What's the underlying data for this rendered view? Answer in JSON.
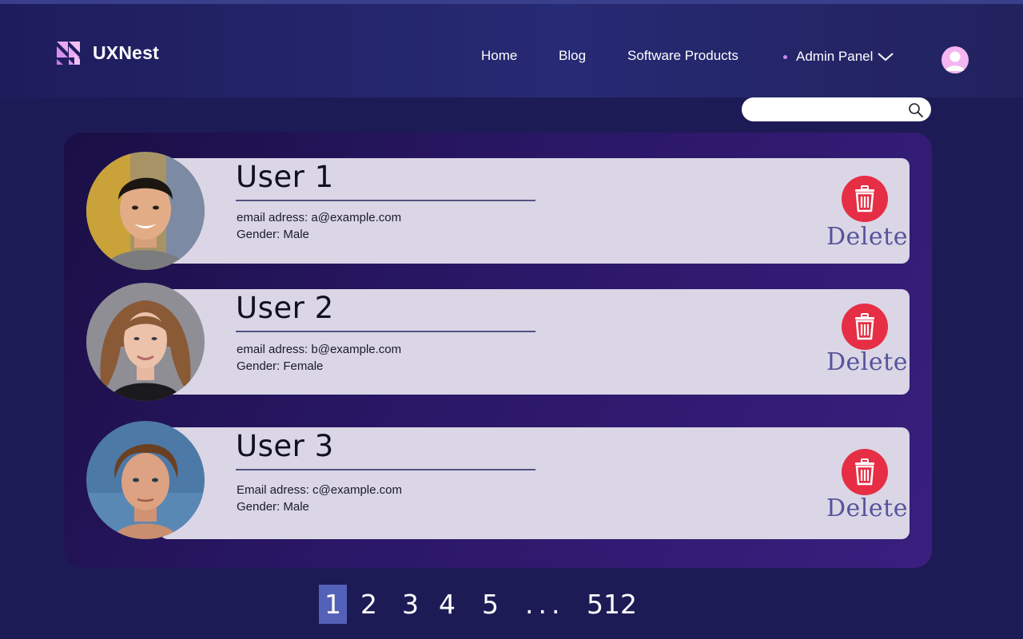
{
  "brand": {
    "name": "UXNest"
  },
  "nav": {
    "home": "Home",
    "blog": "Blog",
    "products": "Software Products",
    "admin": "Admin Panel"
  },
  "search": {
    "value": "",
    "placeholder": ""
  },
  "users": [
    {
      "name": "User 1",
      "email": "email adress: a@example.com",
      "gender": "Gender: Male",
      "delete_label": "Delete"
    },
    {
      "name": "User 2",
      "email": "email adress: b@example.com",
      "gender": "Gender: Female",
      "delete_label": "Delete"
    },
    {
      "name": "User 3",
      "email": "Email adress: c@example.com",
      "gender": "Gender: Male",
      "delete_label": "Delete"
    }
  ],
  "pagination": {
    "pages": [
      "1",
      "2",
      "3",
      "4",
      "5"
    ],
    "ellipsis": "...",
    "last": "512",
    "current": "1"
  },
  "colors": {
    "background": "#1d1b55",
    "accent_delete": "#e62e45",
    "card": "#dad6e6",
    "pagination_active": "#5461b8"
  },
  "icons": {
    "logo": "logo-icon",
    "chevron": "chevron-down-icon",
    "avatar": "user-avatar-icon",
    "search": "search-icon",
    "delete": "trash-icon"
  }
}
